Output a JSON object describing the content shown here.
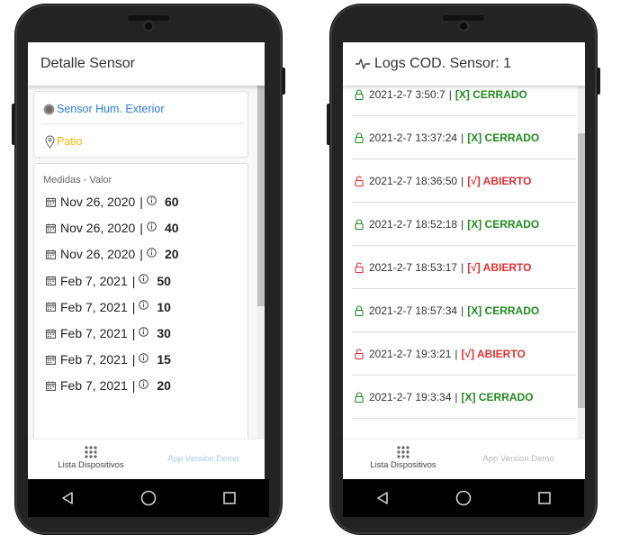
{
  "left_screen": {
    "title": "Detalle Sensor",
    "sensor_name": "Sensor Hum. Exterior",
    "location": "Patio",
    "measures_header": "Medidas - Valor",
    "measures": [
      {
        "date": "Nov 26, 2020",
        "sep": "|",
        "value": "60"
      },
      {
        "date": "Nov 26, 2020",
        "sep": "|",
        "value": "40"
      },
      {
        "date": "Nov 26, 2020",
        "sep": "|",
        "value": "20"
      },
      {
        "date": "Feb 7, 2021",
        "sep": "|",
        "value": "50"
      },
      {
        "date": "Feb 7, 2021",
        "sep": "|",
        "value": "10"
      },
      {
        "date": "Feb 7, 2021",
        "sep": "|",
        "value": "30"
      },
      {
        "date": "Feb 7, 2021",
        "sep": "|",
        "value": "15"
      },
      {
        "date": "Feb 7, 2021",
        "sep": "|",
        "value": "20"
      }
    ],
    "nav_list_label": "Lista Dispositivos",
    "nav_version_label": "App Version Demo"
  },
  "right_screen": {
    "title": "Logs COD. Sensor: 1",
    "logs": [
      {
        "time": "2021-2-7 3:50:7",
        "sep": "|",
        "status": "[X] CERRADO",
        "state": "closed"
      },
      {
        "time": "2021-2-7 13:37:24",
        "sep": "|",
        "status": "[X] CERRADO",
        "state": "closed"
      },
      {
        "time": "2021-2-7 18:36:50",
        "sep": "|",
        "status": "[√] ABIERTO",
        "state": "open"
      },
      {
        "time": "2021-2-7 18:52:18",
        "sep": "|",
        "status": "[X] CERRADO",
        "state": "closed"
      },
      {
        "time": "2021-2-7 18:53:17",
        "sep": "|",
        "status": "[√] ABIERTO",
        "state": "open"
      },
      {
        "time": "2021-2-7 18:57:34",
        "sep": "|",
        "status": "[X] CERRADO",
        "state": "closed"
      },
      {
        "time": "2021-2-7 19:3:21",
        "sep": "|",
        "status": "[√] ABIERTO",
        "state": "open"
      },
      {
        "time": "2021-2-7 19:3:34",
        "sep": "|",
        "status": "[X] CERRADO",
        "state": "closed"
      }
    ],
    "nav_list_label": "Lista Dispositivos",
    "nav_version_label": "App Version Demo"
  },
  "colors": {
    "link_blue": "#2a7de1",
    "location_yellow": "#f2b705",
    "closed_green": "#1e8c1e",
    "open_red": "#e03030",
    "disabled_blue": "#a9c9f0",
    "disabled_gray": "#b8b8b8"
  },
  "icons": [
    "radio-dot-icon",
    "map-pin-icon",
    "calendar-icon",
    "info-icon",
    "pulse-icon",
    "lock-closed-icon",
    "lock-open-icon",
    "grid-icon",
    "back-triangle-icon",
    "home-circle-icon",
    "recents-square-icon"
  ]
}
